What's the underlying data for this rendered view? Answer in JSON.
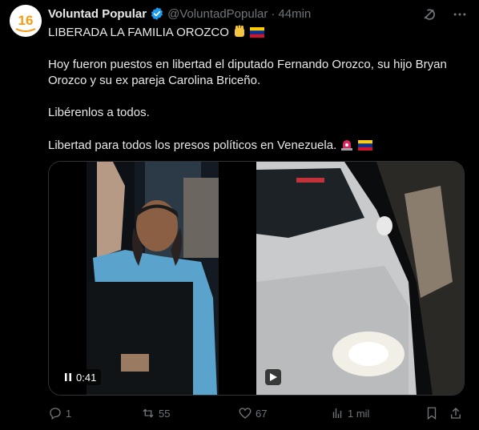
{
  "author": {
    "name": "Voluntad Popular",
    "handle": "@VoluntadPopular",
    "separator": "·",
    "time": "44min",
    "avatar_text": "16"
  },
  "tweet": {
    "title": "LIBERADA LA FAMILIA OROZCO",
    "paragraph1": "Hoy fueron puestos en libertad el diputado Fernando Orozco, su hijo Bryan Orozco y su ex pareja Carolina Briceño.",
    "paragraph2": "Libérenlos a todos.",
    "paragraph3": "Libertad para todos los presos políticos en Venezuela."
  },
  "media": {
    "video1_duration": "0:41",
    "video1_icon": "pause-icon",
    "video2_icon": "play-icon"
  },
  "actions": {
    "replies": "1",
    "reposts": "55",
    "likes": "67",
    "views": "1 mil"
  },
  "colors": {
    "background": "#000000",
    "text": "#e7e9ea",
    "muted": "#71767b",
    "verified": "#1d9bf0",
    "border": "#2f3336"
  }
}
